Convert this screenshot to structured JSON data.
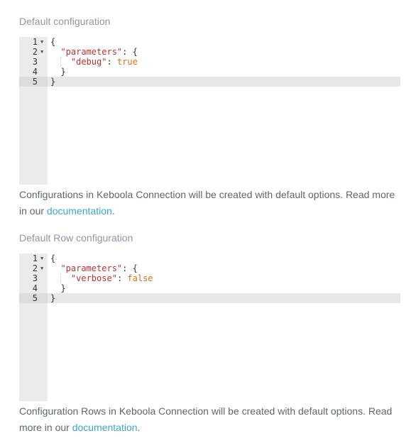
{
  "sections": [
    {
      "label": "Default configuration",
      "editor": {
        "lines": [
          {
            "num": "1",
            "fold": true,
            "parts": [
              {
                "t": "{",
                "c": "p"
              }
            ]
          },
          {
            "num": "2",
            "fold": true,
            "parts": [
              {
                "t": "  ",
                "c": "p"
              },
              {
                "t": "\"parameters\"",
                "c": "k"
              },
              {
                "t": ": {",
                "c": "p"
              }
            ]
          },
          {
            "num": "3",
            "fold": false,
            "parts": [
              {
                "t": "    ",
                "c": "p"
              },
              {
                "t": "\"debug\"",
                "c": "k"
              },
              {
                "t": ": ",
                "c": "p"
              },
              {
                "t": "true",
                "c": "b"
              }
            ]
          },
          {
            "num": "4",
            "fold": false,
            "parts": [
              {
                "t": "  }",
                "c": "p"
              }
            ]
          },
          {
            "num": "5",
            "fold": false,
            "active": true,
            "parts": [
              {
                "t": "}",
                "c": "p"
              }
            ]
          }
        ]
      },
      "description": {
        "text": "Configurations in Keboola Connection will be created with default options. Read more in our ",
        "link": "documentation",
        "suffix": "."
      }
    },
    {
      "label": "Default Row configuration",
      "editor": {
        "lines": [
          {
            "num": "1",
            "fold": true,
            "parts": [
              {
                "t": "{",
                "c": "p"
              }
            ]
          },
          {
            "num": "2",
            "fold": true,
            "parts": [
              {
                "t": "  ",
                "c": "p"
              },
              {
                "t": "\"parameters\"",
                "c": "k"
              },
              {
                "t": ": {",
                "c": "p"
              }
            ]
          },
          {
            "num": "3",
            "fold": false,
            "parts": [
              {
                "t": "    ",
                "c": "p"
              },
              {
                "t": "\"verbose\"",
                "c": "k"
              },
              {
                "t": ": ",
                "c": "p"
              },
              {
                "t": "false",
                "c": "b"
              }
            ]
          },
          {
            "num": "4",
            "fold": false,
            "parts": [
              {
                "t": "  }",
                "c": "p"
              }
            ]
          },
          {
            "num": "5",
            "fold": false,
            "active": true,
            "parts": [
              {
                "t": "}",
                "c": "p"
              }
            ]
          }
        ]
      },
      "description": {
        "text": "Configuration Rows in Keboola Connection will be created with default options. Read more in our ",
        "link": "documentation",
        "suffix": "."
      }
    }
  ],
  "colors": {
    "key": "#b8322d",
    "boolean": "#d96f14",
    "link": "#3ca6c7",
    "label": "#8f97a0",
    "gutter": "#ebebeb"
  },
  "icons": {
    "fold": "fold-arrow-icon"
  }
}
